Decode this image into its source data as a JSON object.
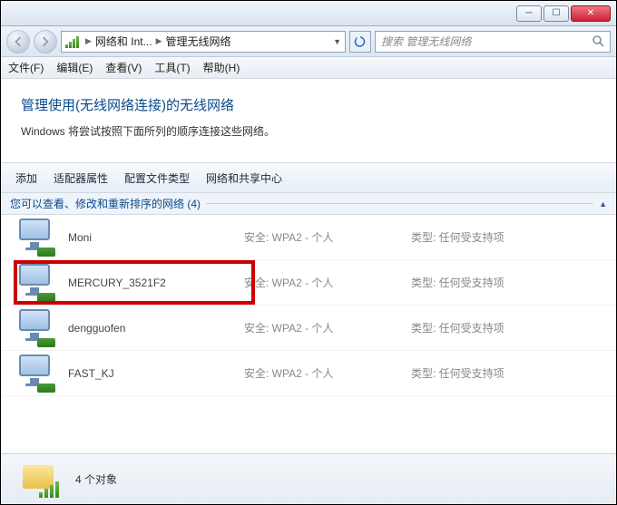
{
  "titlebar": {
    "minimize": "─",
    "maximize": "☐",
    "close": "✕"
  },
  "nav": {
    "crumb1": "网络和 Int...",
    "crumb2": "管理无线网络",
    "search_placeholder": "搜索 管理无线网络"
  },
  "menu": {
    "file": "文件(F)",
    "edit": "编辑(E)",
    "view": "查看(V)",
    "tools": "工具(T)",
    "help": "帮助(H)"
  },
  "page": {
    "title": "管理使用(无线网络连接)的无线网络",
    "desc": "Windows 将尝试按照下面所列的顺序连接这些网络。"
  },
  "toolbar": {
    "add": "添加",
    "adapter": "适配器属性",
    "profile": "配置文件类型",
    "center": "网络和共享中心"
  },
  "group": {
    "header": "您可以查看、修改和重新排序的网络 (4)"
  },
  "col": {
    "security_prefix": "安全:",
    "type_prefix": "类型:"
  },
  "networks": [
    {
      "name": "Moni",
      "security": "WPA2 - 个人",
      "type": "任何受支持项",
      "highlight": false
    },
    {
      "name": "MERCURY_3521F2",
      "security": "WPA2 - 个人",
      "type": "任何受支持项",
      "highlight": true
    },
    {
      "name": "dengguofen",
      "security": "WPA2 - 个人",
      "type": "任何受支持项",
      "highlight": false
    },
    {
      "name": "FAST_KJ",
      "security": "WPA2 - 个人",
      "type": "任何受支持项",
      "highlight": false
    }
  ],
  "status": {
    "count_text": "4 个对象"
  }
}
